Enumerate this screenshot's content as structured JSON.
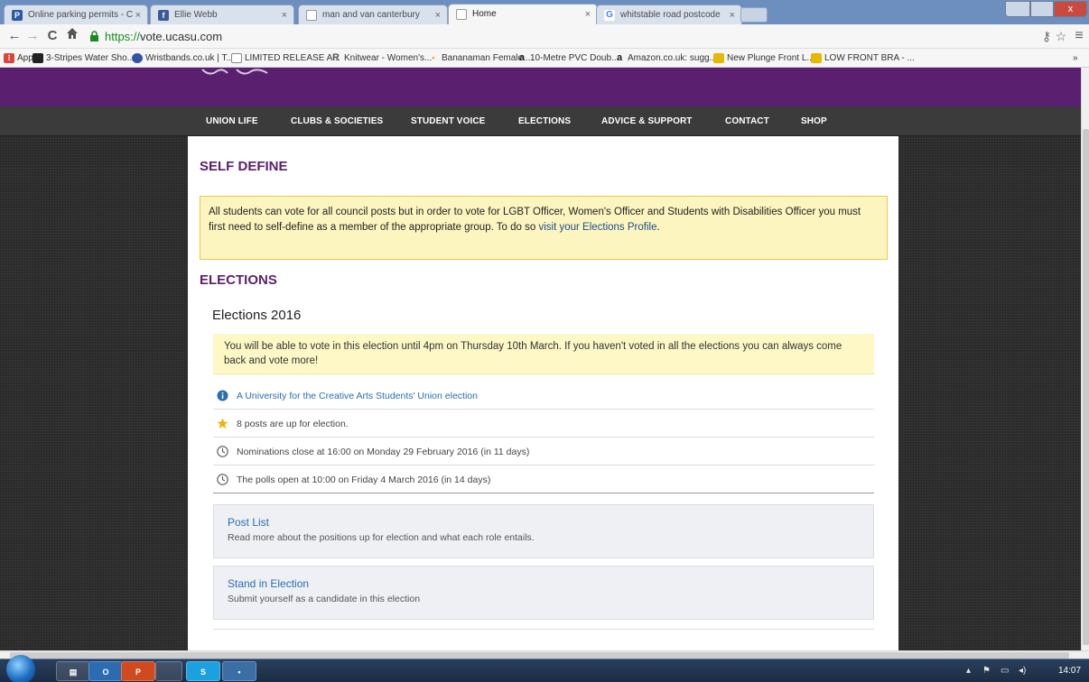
{
  "browser": {
    "tabs": [
      {
        "title": "Online parking permits - C",
        "favicon": "parking-favicon"
      },
      {
        "title": "Ellie Webb",
        "favicon": "facebook-favicon"
      },
      {
        "title": "man and van canterbury",
        "favicon": "page-favicon"
      },
      {
        "title": "Home",
        "favicon": "page-favicon",
        "active": true
      },
      {
        "title": "whitstable road postcode",
        "favicon": "google-favicon"
      }
    ],
    "url_scheme": "https://",
    "url_host": "vote.ucasu.com",
    "bookmarks": [
      "Apps",
      "3-Stripes Water Sho...",
      "Wristbands.co.uk | T...",
      "LIMITED RELEASE A...",
      "Knitwear - Women's...",
      "Bananaman Female ...",
      "10-Metre PVC Doub...",
      "Amazon.co.uk: sugg...",
      "New Plunge Front L...",
      "LOW FRONT BRA - ..."
    ],
    "bookmarks_overflow": "»"
  },
  "site": {
    "colors": {
      "brand": "#5a1f6e",
      "nav_bg": "#3b3b3b",
      "link": "#2a6db3",
      "notice_bg": "#fdf5bf"
    },
    "nav": [
      "UNION LIFE",
      "CLUBS & SOCIETIES",
      "STUDENT VOICE",
      "ELECTIONS",
      "ADVICE & SUPPORT",
      "CONTACT",
      "SHOP"
    ],
    "self_define": {
      "heading": "SELF DEFINE",
      "text": "All students can vote for all council posts but in order to vote for LGBT Officer, Women's Officer and Students with Disabilities Officer you must first need to self-define as a member of the appropriate group. To do so ",
      "link": "visit your Elections Profile",
      "end": "."
    },
    "elections": {
      "heading": "ELECTIONS",
      "name": "Elections 2016",
      "notice": "You will be able to vote in this election until 4pm on Thursday 10th March. If you haven't voted in all the elections you can always come back and vote more!",
      "rows": [
        {
          "icon": "info-icon",
          "text": "A University for the Creative Arts Students' Union election",
          "link": true
        },
        {
          "icon": "star-icon",
          "text": "8 posts are up for election."
        },
        {
          "icon": "clock-icon",
          "text": "Nominations close at 16:00 on Monday 29 February 2016 (in 11 days)"
        },
        {
          "icon": "clock-icon",
          "text": "The polls open at 10:00 on Friday 4 March 2016 (in 14 days)"
        }
      ],
      "cards": [
        {
          "title": "Post List",
          "desc": "Read more about the positions up for election and what each role entails."
        },
        {
          "title": "Stand in Election",
          "desc": "Submit yourself as a candidate in this election"
        }
      ]
    }
  },
  "taskbar": {
    "clock": "14:07",
    "apps": [
      "explorer",
      "outlook",
      "powerpoint",
      "window",
      "skype",
      "app"
    ]
  }
}
